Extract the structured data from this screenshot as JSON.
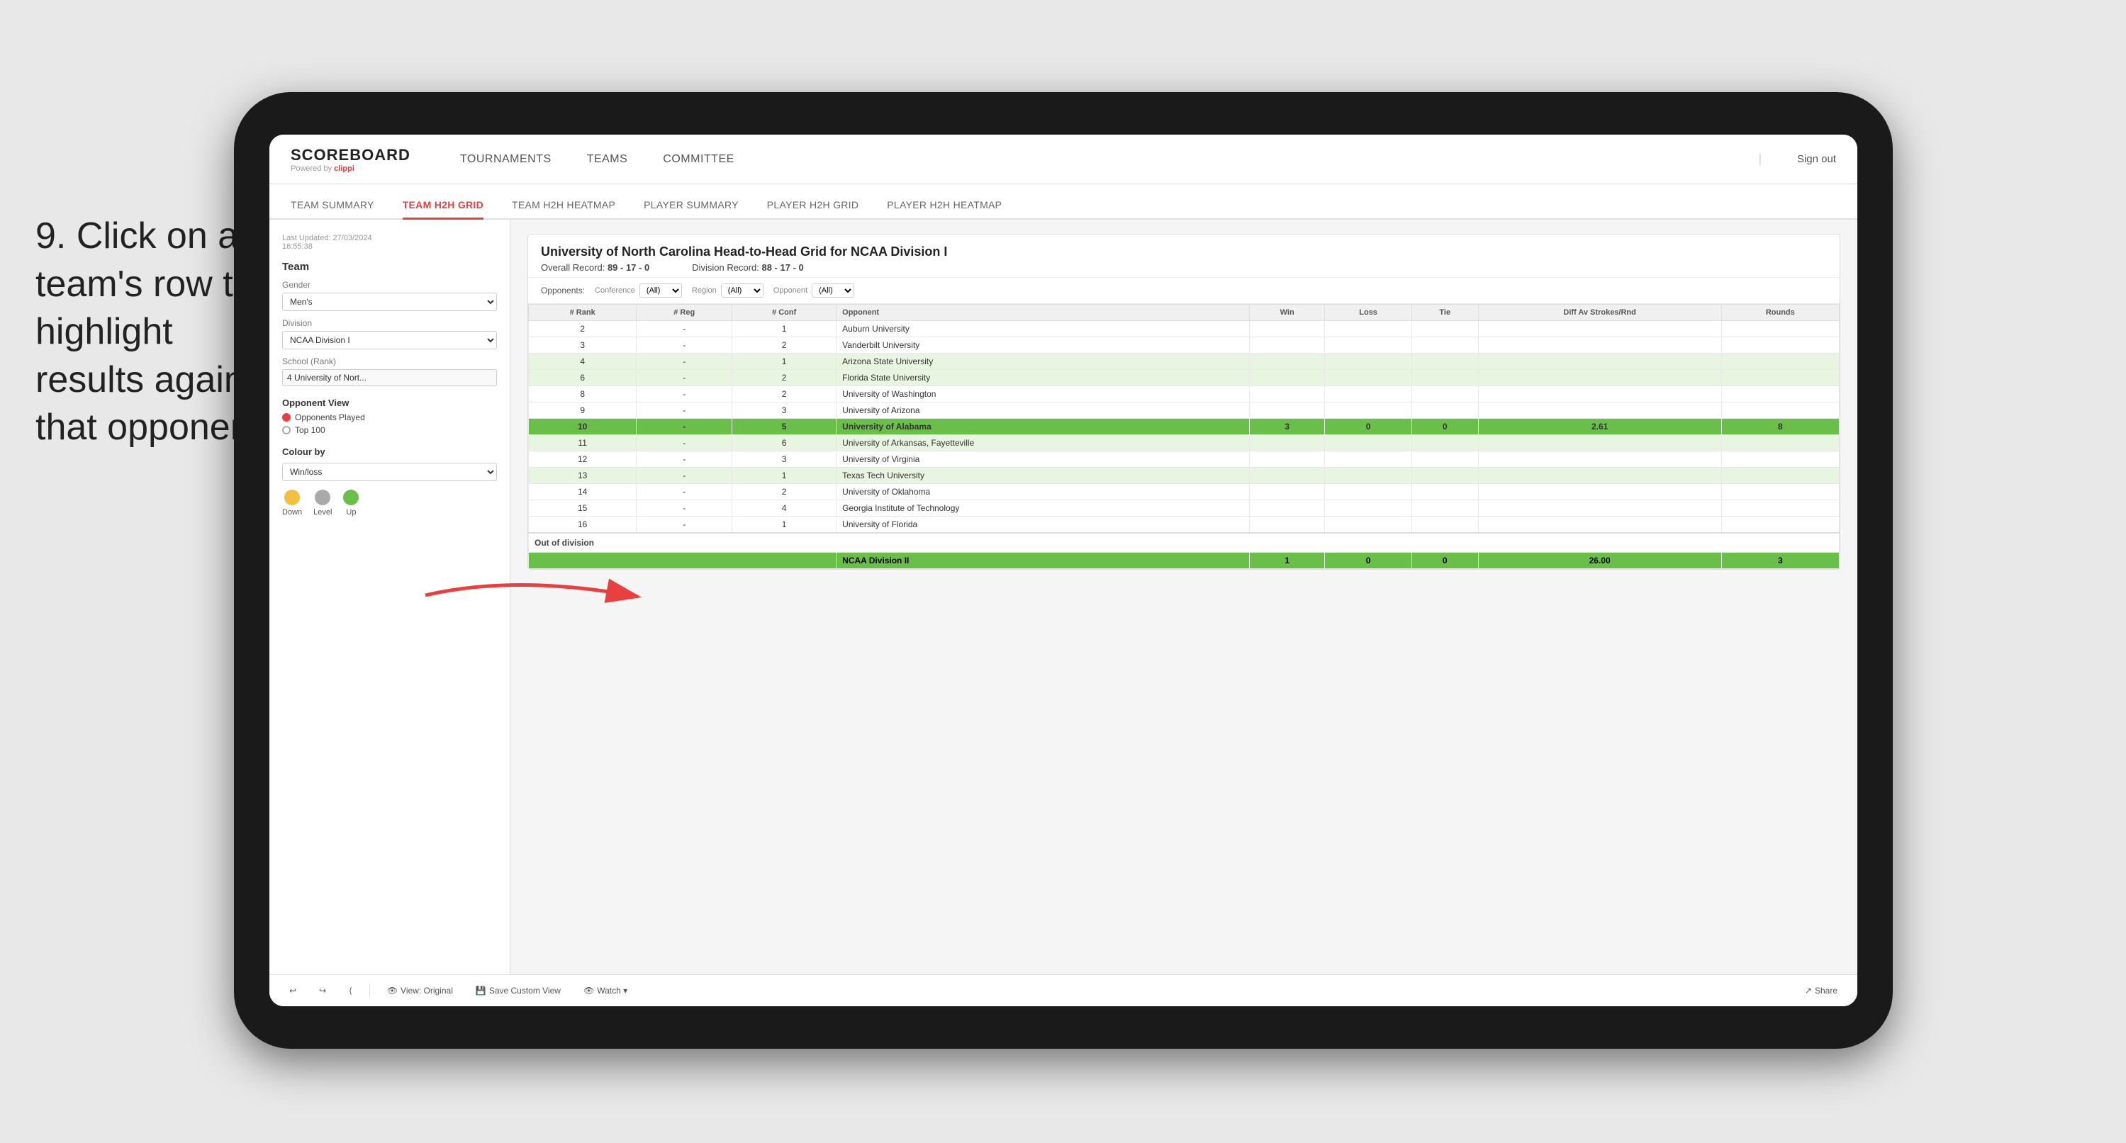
{
  "instruction": {
    "step": "9.",
    "text": "Click on a team's row to highlight results against that opponent"
  },
  "nav": {
    "logo": "SCOREBOARD",
    "logo_sub": "Powered by",
    "logo_brand": "clippi",
    "items": [
      "TOURNAMENTS",
      "TEAMS",
      "COMMITTEE"
    ],
    "sign_out": "Sign out"
  },
  "sub_tabs": [
    {
      "label": "TEAM SUMMARY",
      "active": false
    },
    {
      "label": "TEAM H2H GRID",
      "active": true
    },
    {
      "label": "TEAM H2H HEATMAP",
      "active": false
    },
    {
      "label": "PLAYER SUMMARY",
      "active": false
    },
    {
      "label": "PLAYER H2H GRID",
      "active": false
    },
    {
      "label": "PLAYER H2H HEATMAP",
      "active": false
    }
  ],
  "sidebar": {
    "timestamp_label": "Last Updated: 27/03/2024",
    "timestamp_time": "16:55:38",
    "team_label": "Team",
    "gender_label": "Gender",
    "gender_value": "Men's",
    "division_label": "Division",
    "division_value": "NCAA Division I",
    "school_label": "School (Rank)",
    "school_value": "4 University of Nort...",
    "opponent_view_title": "Opponent View",
    "radio_options": [
      {
        "label": "Opponents Played",
        "selected": true
      },
      {
        "label": "Top 100",
        "selected": false
      }
    ],
    "colour_by_title": "Colour by",
    "colour_by_value": "Win/loss",
    "legend": [
      {
        "label": "Down",
        "color": "#f0c040"
      },
      {
        "label": "Level",
        "color": "#aaa"
      },
      {
        "label": "Up",
        "color": "#6abf4b"
      }
    ]
  },
  "grid": {
    "title": "University of North Carolina Head-to-Head Grid for NCAA Division I",
    "overall_record_label": "Overall Record:",
    "overall_record": "89 - 17 - 0",
    "division_record_label": "Division Record:",
    "division_record": "88 - 17 - 0",
    "filters": {
      "opponents_label": "Opponents:",
      "conference_label": "Conference",
      "conference_value": "(All)",
      "region_label": "Region",
      "region_value": "(All)",
      "opponent_label": "Opponent",
      "opponent_value": "(All)"
    },
    "col_headers": [
      "#\nRank",
      "#\nReg",
      "#\nConf",
      "Opponent",
      "Win",
      "Loss",
      "Tie",
      "Diff Av\nStrokes/Rnd",
      "Rounds"
    ],
    "rows": [
      {
        "rank": "2",
        "reg": "-",
        "conf": "1",
        "opponent": "Auburn University",
        "win": "",
        "loss": "",
        "tie": "",
        "diff": "",
        "rounds": "",
        "style": "normal"
      },
      {
        "rank": "3",
        "reg": "-",
        "conf": "2",
        "opponent": "Vanderbilt University",
        "win": "",
        "loss": "",
        "tie": "",
        "diff": "",
        "rounds": "",
        "style": "normal"
      },
      {
        "rank": "4",
        "reg": "-",
        "conf": "1",
        "opponent": "Arizona State University",
        "win": "",
        "loss": "",
        "tie": "",
        "diff": "",
        "rounds": "",
        "style": "light-green"
      },
      {
        "rank": "6",
        "reg": "-",
        "conf": "2",
        "opponent": "Florida State University",
        "win": "",
        "loss": "",
        "tie": "",
        "diff": "",
        "rounds": "",
        "style": "light-green"
      },
      {
        "rank": "8",
        "reg": "-",
        "conf": "2",
        "opponent": "University of Washington",
        "win": "",
        "loss": "",
        "tie": "",
        "diff": "",
        "rounds": "",
        "style": "normal"
      },
      {
        "rank": "9",
        "reg": "-",
        "conf": "3",
        "opponent": "University of Arizona",
        "win": "",
        "loss": "",
        "tie": "",
        "diff": "",
        "rounds": "",
        "style": "normal"
      },
      {
        "rank": "10",
        "reg": "-",
        "conf": "5",
        "opponent": "University of Alabama",
        "win": "3",
        "loss": "0",
        "tie": "0",
        "diff": "2.61",
        "rounds": "8",
        "style": "highlighted"
      },
      {
        "rank": "11",
        "reg": "-",
        "conf": "6",
        "opponent": "University of Arkansas, Fayetteville",
        "win": "",
        "loss": "",
        "tie": "",
        "diff": "",
        "rounds": "",
        "style": "light-green"
      },
      {
        "rank": "12",
        "reg": "-",
        "conf": "3",
        "opponent": "University of Virginia",
        "win": "",
        "loss": "",
        "tie": "",
        "diff": "",
        "rounds": "",
        "style": "normal"
      },
      {
        "rank": "13",
        "reg": "-",
        "conf": "1",
        "opponent": "Texas Tech University",
        "win": "",
        "loss": "",
        "tie": "",
        "diff": "",
        "rounds": "",
        "style": "light-green"
      },
      {
        "rank": "14",
        "reg": "-",
        "conf": "2",
        "opponent": "University of Oklahoma",
        "win": "",
        "loss": "",
        "tie": "",
        "diff": "",
        "rounds": "",
        "style": "normal"
      },
      {
        "rank": "15",
        "reg": "-",
        "conf": "4",
        "opponent": "Georgia Institute of Technology",
        "win": "",
        "loss": "",
        "tie": "",
        "diff": "",
        "rounds": "",
        "style": "normal"
      },
      {
        "rank": "16",
        "reg": "-",
        "conf": "1",
        "opponent": "University of Florida",
        "win": "",
        "loss": "",
        "tie": "",
        "diff": "",
        "rounds": "",
        "style": "normal"
      }
    ],
    "out_division_label": "Out of division",
    "out_division_row": {
      "opponent": "NCAA Division II",
      "win": "1",
      "loss": "0",
      "tie": "0",
      "diff": "26.00",
      "rounds": "3"
    }
  },
  "toolbar": {
    "undo": "↩",
    "redo": "↪",
    "view_original": "View: Original",
    "save_custom": "Save Custom View",
    "watch": "Watch ▾",
    "share": "Share"
  },
  "colors": {
    "active_tab": "#e84040",
    "row_highlighted": "#6abf4b",
    "row_selected": "#6abf4b",
    "row_light": "#e8f5e0",
    "legend_down": "#f0c040",
    "legend_level": "#aaa",
    "legend_up": "#6abf4b"
  }
}
